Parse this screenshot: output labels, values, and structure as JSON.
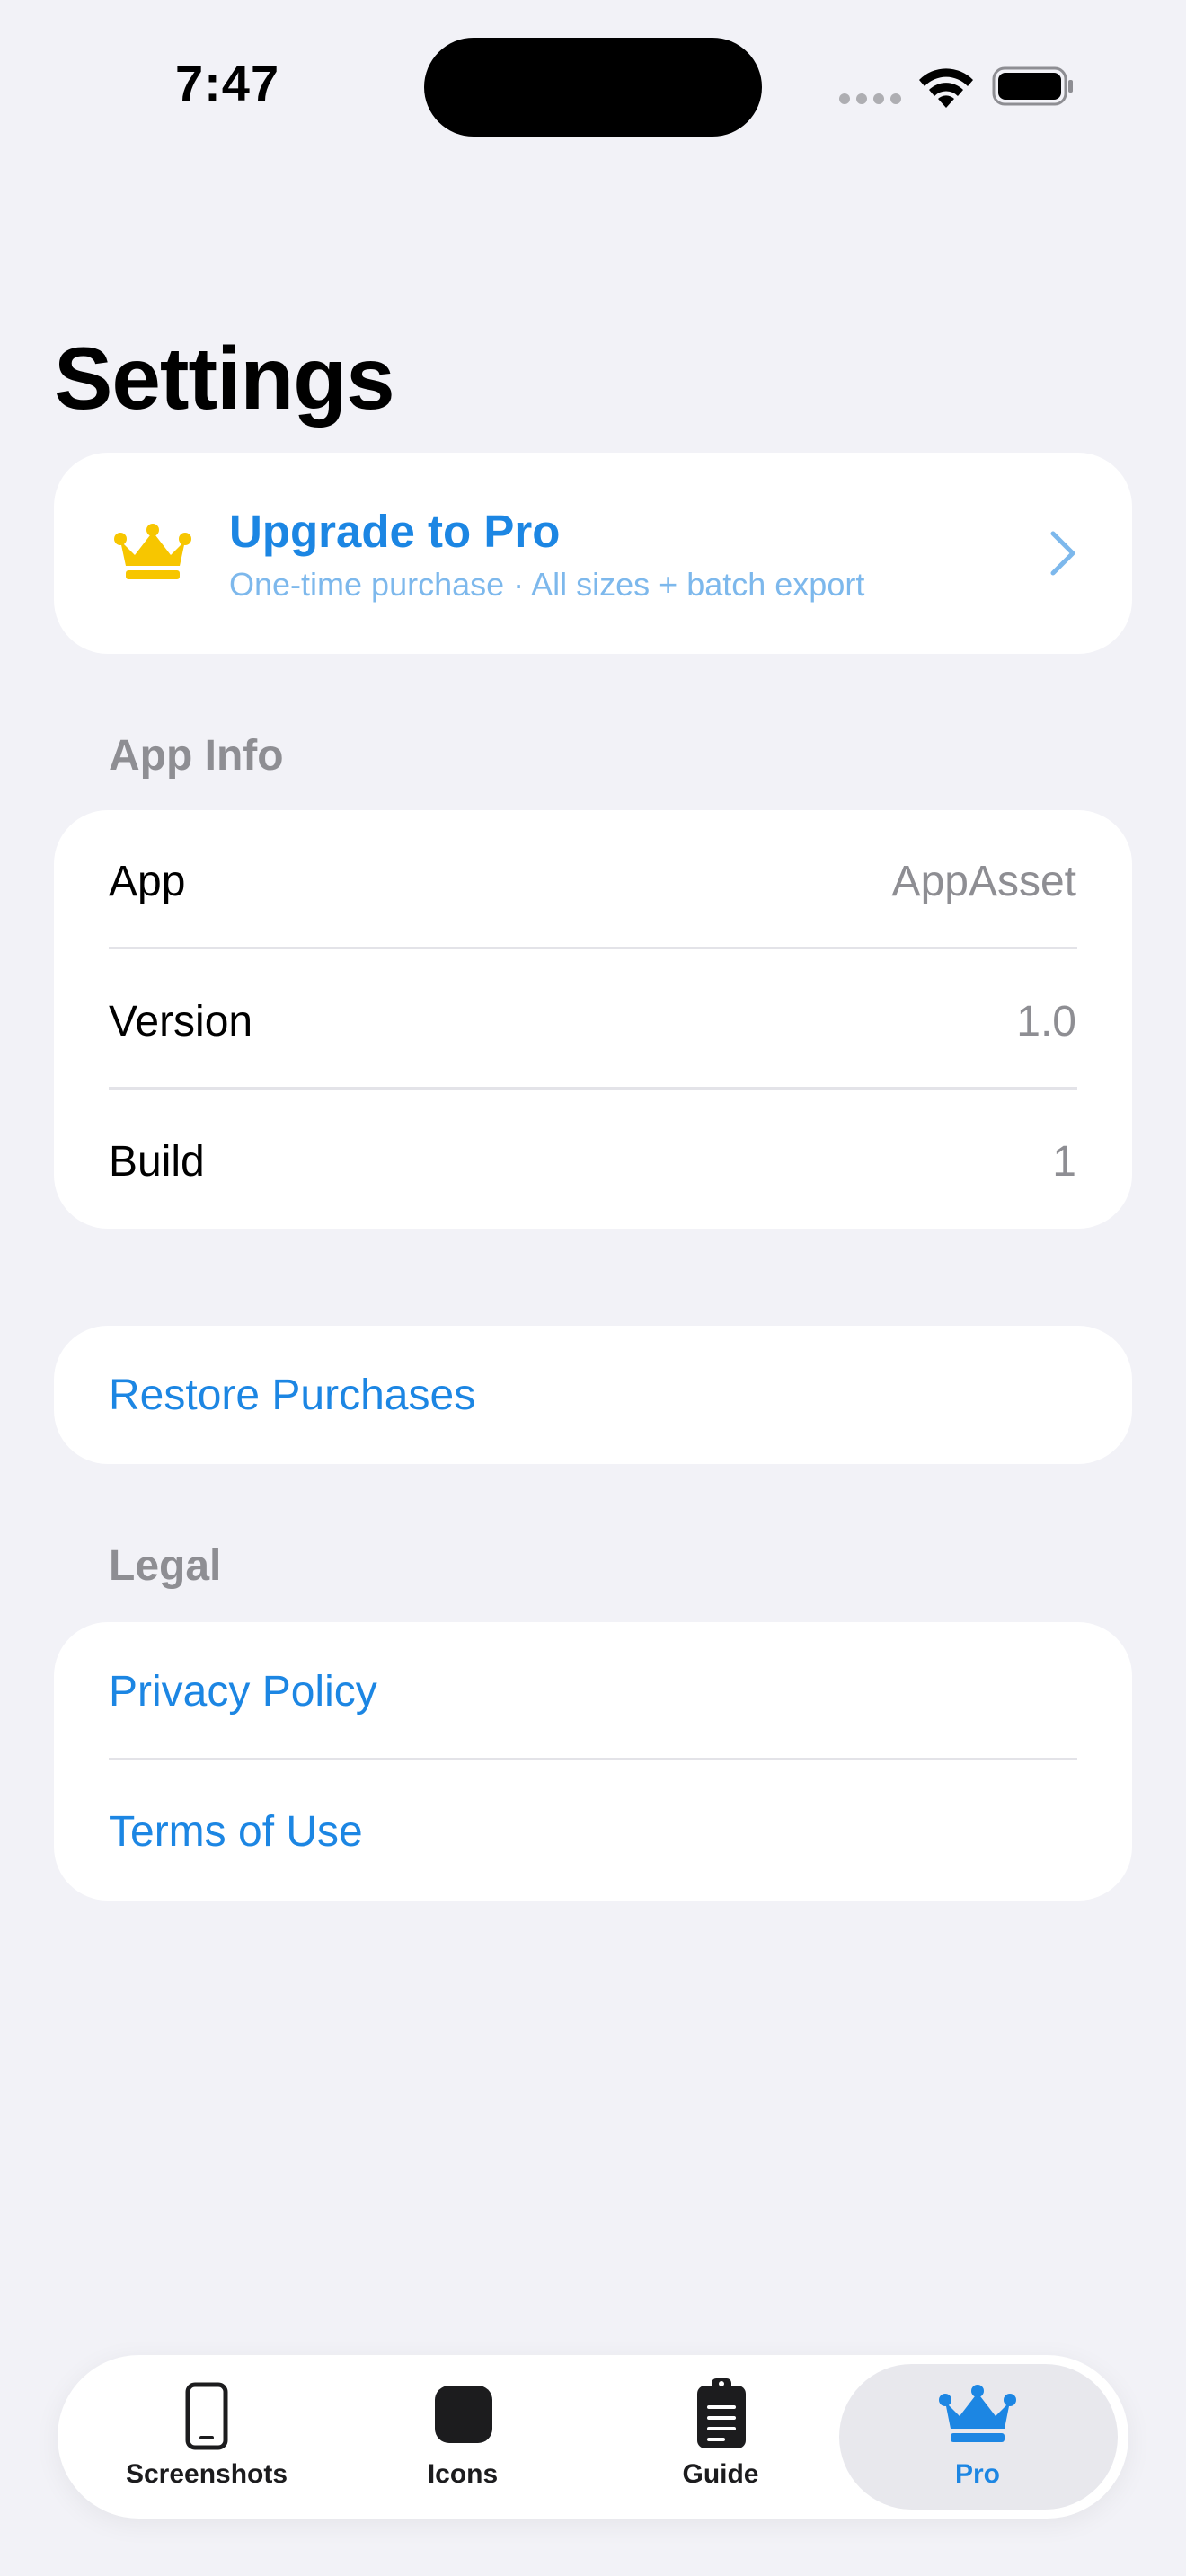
{
  "status_bar": {
    "time": "7:47"
  },
  "page": {
    "title": "Settings"
  },
  "pro_banner": {
    "icon": "crown-icon",
    "title": "Upgrade to Pro",
    "subtitle": "One-time purchase · All sizes + batch export",
    "chevron": "chevron-right-icon"
  },
  "app_info": {
    "header": "App Info",
    "rows": [
      {
        "label": "App",
        "value": "AppAsset"
      },
      {
        "label": "Version",
        "value": "1.0"
      },
      {
        "label": "Build",
        "value": "1"
      }
    ]
  },
  "restore": {
    "label": "Restore Purchases"
  },
  "legal": {
    "header": "Legal",
    "links": [
      {
        "label": "Privacy Policy"
      },
      {
        "label": "Terms of Use"
      }
    ]
  },
  "tab_bar": {
    "tabs": [
      {
        "label": "Screenshots",
        "icon": "phone-icon"
      },
      {
        "label": "Icons",
        "icon": "app-icon"
      },
      {
        "label": "Guide",
        "icon": "clipboard-icon"
      },
      {
        "label": "Pro",
        "icon": "crown-icon"
      }
    ],
    "selected": "Pro"
  },
  "colors": {
    "accent": "#1C86E3",
    "crown": "#F7C600",
    "background": "#F2F2F7",
    "secondary_text": "#8E8E93"
  }
}
